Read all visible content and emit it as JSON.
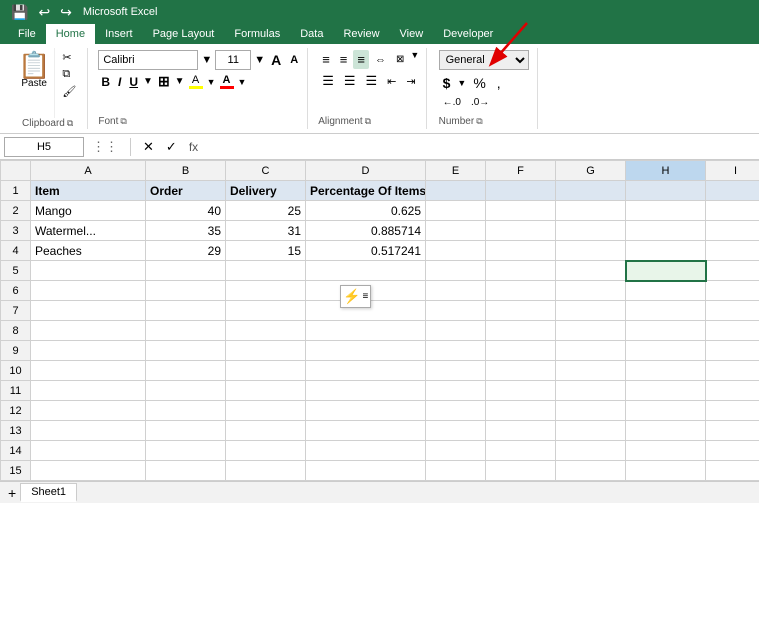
{
  "ribbon": {
    "tabs": [
      "File",
      "Home",
      "Insert",
      "Page Layout",
      "Formulas",
      "Data",
      "Review",
      "View",
      "Developer"
    ],
    "active_tab": "Home"
  },
  "qat": {
    "save": "💾",
    "undo": "↩",
    "redo": "↪"
  },
  "clipboard": {
    "paste_label": "Paste",
    "cut_label": "✂",
    "copy_label": "⧉",
    "format_painter_label": "🖌",
    "group_label": "Clipboard"
  },
  "font": {
    "name": "Calibri",
    "size": "11",
    "bold": "B",
    "italic": "I",
    "underline": "U",
    "increase_size": "A",
    "decrease_size": "A",
    "group_label": "Font"
  },
  "alignment": {
    "group_label": "Alignment"
  },
  "number": {
    "format": "General",
    "dollar": "$",
    "percent": "%",
    "comma": ",",
    "increase_decimal": ".0",
    "decrease_decimal": ".00",
    "group_label": "Number"
  },
  "formula_bar": {
    "cell_ref": "H5",
    "cancel": "✕",
    "confirm": "✓",
    "fx": "fx",
    "value": ""
  },
  "columns": [
    "",
    "A",
    "B",
    "C",
    "D",
    "E",
    "F",
    "G",
    "H",
    "I"
  ],
  "rows": [
    {
      "num": 1,
      "A": "Item",
      "B": "Order",
      "C": "Delivery",
      "D": "Percentage Of Items Delivered",
      "E": "",
      "F": "",
      "G": "",
      "H": "",
      "I": ""
    },
    {
      "num": 2,
      "A": "Mango",
      "B": "40",
      "C": "25",
      "D": "0.625",
      "E": "",
      "F": "",
      "G": "",
      "H": "",
      "I": ""
    },
    {
      "num": 3,
      "A": "Watermel...",
      "B": "35",
      "C": "31",
      "D": "0.885714",
      "E": "",
      "F": "",
      "G": "",
      "H": "",
      "I": ""
    },
    {
      "num": 4,
      "A": "Peaches",
      "B": "29",
      "C": "15",
      "D": "0.517241",
      "E": "",
      "F": "",
      "G": "",
      "H": "",
      "I": ""
    },
    {
      "num": 5,
      "A": "",
      "B": "",
      "C": "",
      "D": "",
      "E": "",
      "F": "",
      "G": "",
      "H": "",
      "I": ""
    },
    {
      "num": 6,
      "A": "",
      "B": "",
      "C": "",
      "D": "",
      "E": "",
      "F": "",
      "G": "",
      "H": "",
      "I": ""
    },
    {
      "num": 7,
      "A": "",
      "B": "",
      "C": "",
      "D": "",
      "E": "",
      "F": "",
      "G": "",
      "H": "",
      "I": ""
    },
    {
      "num": 8,
      "A": "",
      "B": "",
      "C": "",
      "D": "",
      "E": "",
      "F": "",
      "G": "",
      "H": "",
      "I": ""
    },
    {
      "num": 9,
      "A": "",
      "B": "",
      "C": "",
      "D": "",
      "E": "",
      "F": "",
      "G": "",
      "H": "",
      "I": ""
    },
    {
      "num": 10,
      "A": "",
      "B": "",
      "C": "",
      "D": "",
      "E": "",
      "F": "",
      "G": "",
      "H": "",
      "I": ""
    },
    {
      "num": 11,
      "A": "",
      "B": "",
      "C": "",
      "D": "",
      "E": "",
      "F": "",
      "G": "",
      "H": "",
      "I": ""
    },
    {
      "num": 12,
      "A": "",
      "B": "",
      "C": "",
      "D": "",
      "E": "",
      "F": "",
      "G": "",
      "H": "",
      "I": ""
    },
    {
      "num": 13,
      "A": "",
      "B": "",
      "C": "",
      "D": "",
      "E": "",
      "F": "",
      "G": "",
      "H": "",
      "I": ""
    },
    {
      "num": 14,
      "A": "",
      "B": "",
      "C": "",
      "D": "",
      "E": "",
      "F": "",
      "G": "",
      "H": "",
      "I": ""
    },
    {
      "num": 15,
      "A": "",
      "B": "",
      "C": "",
      "D": "",
      "E": "",
      "F": "",
      "G": "",
      "H": "",
      "I": ""
    }
  ],
  "selected_cell": "H5",
  "sheet_tab": "Sheet1",
  "arrow": {
    "color": "#e00000",
    "label": "red arrow pointing to number group"
  }
}
